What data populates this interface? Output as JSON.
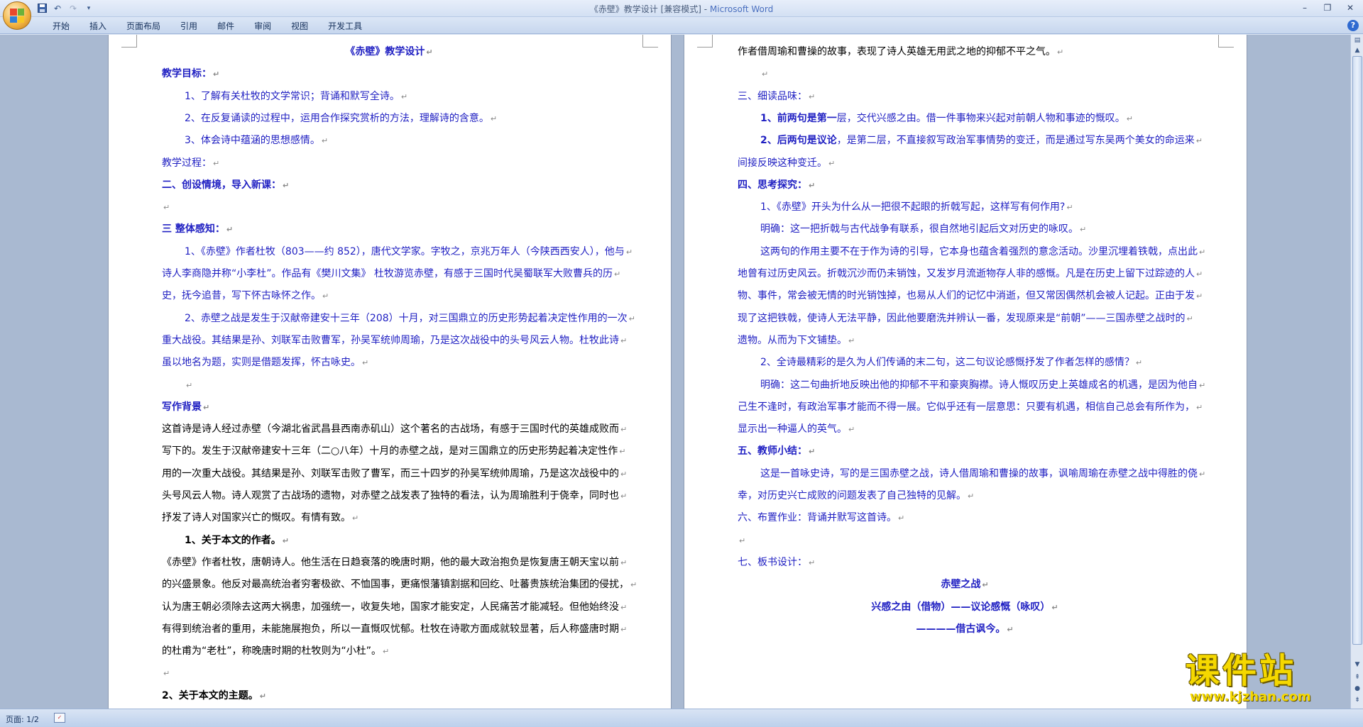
{
  "window": {
    "title_prefix": "《赤壁》教学设计 [兼容模式] - ",
    "app_name": "Microsoft Word"
  },
  "quick_access": [
    "save-icon",
    "undo-icon",
    "redo-icon",
    "customize-icon"
  ],
  "ribbon_tabs": [
    "开始",
    "插入",
    "页面布局",
    "引用",
    "邮件",
    "审阅",
    "视图",
    "开发工具"
  ],
  "status": {
    "page": "页面: 1/2"
  },
  "watermark": {
    "title": "课件站",
    "url": "www.kjzhan.com"
  },
  "left_page": [
    {
      "t": "《赤壁》教学设计",
      "style": "blue bold center"
    },
    {
      "t": "教学目标：",
      "style": "blue bold"
    },
    {
      "t": "1、了解有关杜牧的文学常识；背诵和默写全诗。",
      "style": "blue",
      "indent": 1
    },
    {
      "t": "2、在反复诵读的过程中，运用合作探究赏析的方法，理解诗的含意。",
      "style": "blue",
      "indent": 1
    },
    {
      "t": "3、体会诗中蕴涵的思想感情。",
      "style": "blue",
      "indent": 1
    },
    {
      "t": "教学过程：",
      "style": "blue"
    },
    {
      "t": "二、创设情境，导入新课：",
      "style": "blue bold"
    },
    {
      "t": "",
      "style": ""
    },
    {
      "t": "三 整体感知：",
      "style": "blue bold"
    },
    {
      "t": "1、《赤壁》作者杜牧（803——约 852），唐代文学家。字牧之，京兆万年人（今陕西西安人），他与",
      "style": "blue",
      "indent": 1
    },
    {
      "t": "诗人李商隐并称“小李杜”。作品有《樊川文集》 杜牧游览赤壁，有感于三国时代吴蜀联军大败曹兵的历",
      "style": "blue"
    },
    {
      "t": "史，抚今追昔，写下怀古咏怀之作。",
      "style": "blue"
    },
    {
      "t": "2、赤壁之战是发生于汉献帝建安十三年（208）十月，对三国鼎立的历史形势起着决定性作用的一次",
      "style": "blue",
      "indent": 1
    },
    {
      "t": "重大战役。其结果是孙、刘联军击败曹军，孙吴军统帅周瑜，乃是这次战役中的头号风云人物。杜牧此诗",
      "style": "blue"
    },
    {
      "t": "虽以地名为题，实则是借题发挥，怀古咏史。",
      "style": "blue"
    },
    {
      "t": "",
      "style": "",
      "indent": 1
    },
    {
      "t": "写作背景",
      "style": "blue bold"
    },
    {
      "t": "这首诗是诗人经过赤壁（今湖北省武昌县西南赤矶山）这个著名的古战场，有感于三国时代的英雄成败而",
      "style": ""
    },
    {
      "t": "写下的。发生于汉献帝建安十三年（二○八年）十月的赤壁之战，是对三国鼎立的历史形势起着决定性作",
      "style": ""
    },
    {
      "t": "用的一次重大战役。其结果是孙、刘联军击败了曹军，而三十四岁的孙吴军统帅周瑜，乃是这次战役中的",
      "style": ""
    },
    {
      "t": "头号风云人物。诗人观赏了古战场的遗物，对赤壁之战发表了独特的看法，认为周瑜胜利于侥幸，同时也",
      "style": ""
    },
    {
      "t": "抒发了诗人对国家兴亡的慨叹。有情有致。",
      "style": ""
    },
    {
      "t": "1、关于本文的作者。",
      "style": "bold",
      "indent": 1
    },
    {
      "t": "《赤壁》作者杜牧，唐朝诗人。他生活在日趋衰落的晚唐时期，他的最大政治抱负是恢复唐王朝天宝以前",
      "style": ""
    },
    {
      "t": "的兴盛景象。他反对最高统治者穷奢极欲、不恤国事，更痛恨藩镇割据和回纥、吐蕃贵族统治集团的侵扰，",
      "style": ""
    },
    {
      "t": "认为唐王朝必须除去这两大祸患，加强统一，收复失地，国家才能安定，人民痛苦才能减轻。但他始终没",
      "style": ""
    },
    {
      "t": "有得到统治者的重用，未能施展抱负，所以一直慨叹忧郁。杜牧在诗歌方面成就较显著，后人称盛唐时期",
      "style": ""
    },
    {
      "t": "的杜甫为“老杜”，称晚唐时期的杜牧则为“小杜”。",
      "style": ""
    },
    {
      "t": "",
      "style": ""
    },
    {
      "t": "2、关于本文的主题。",
      "style": "bold"
    }
  ],
  "right_page": [
    {
      "t": "作者借周瑜和曹操的故事，表现了诗人英雄无用武之地的抑郁不平之气。",
      "style": ""
    },
    {
      "t": "",
      "style": "",
      "indent": 1
    },
    {
      "t": "三、细读品味：",
      "style": "blue"
    },
    {
      "t": "1、前两句是第一层，交代兴感之由。借一件事物来兴起对前朝人物和事迹的慨叹。",
      "style": "blue",
      "indent": 1,
      "boldHead": 8
    },
    {
      "t": "2、后两句是议论，是第二层，不直接叙写政治军事情势的变迁，而是通过写东吴两个美女的命运来",
      "style": "blue",
      "indent": 1,
      "boldHead": 8
    },
    {
      "t": "间接反映这种变迁。",
      "style": "blue"
    },
    {
      "t": "四、思考探究：",
      "style": "blue bold"
    },
    {
      "t": "1、《赤壁》开头为什么从一把很不起眼的折戟写起，这样写有何作用?",
      "style": "blue",
      "indent": 1
    },
    {
      "t": "明确：这一把折戟与古代战争有联系，很自然地引起后文对历史的咏叹。",
      "style": "blue",
      "indent": 1
    },
    {
      "t": "这两句的作用主要不在于作为诗的引导，它本身也蕴含着强烈的意念活动。沙里沉埋着铁戟，点出此",
      "style": "blue",
      "indent": 1
    },
    {
      "t": "地曾有过历史风云。折戟沉沙而仍未销蚀，又发岁月流逝物存人非的感慨。凡是在历史上留下过踪迹的人",
      "style": "blue"
    },
    {
      "t": "物、事件，常会被无情的时光销蚀掉，也易从人们的记忆中消逝，但又常因偶然机会被人记起。正由于发",
      "style": "blue"
    },
    {
      "t": "现了这把铁戟，使诗人无法平静，因此他要磨洗并辨认一番，发现原来是“前朝”——三国赤壁之战时的",
      "style": "blue"
    },
    {
      "t": "遗物。从而为下文铺垫。",
      "style": "blue"
    },
    {
      "t": "2、全诗最精彩的是久为人们传诵的末二句，这二句议论感慨抒发了作者怎样的感情？",
      "style": "blue",
      "indent": 1
    },
    {
      "t": "明确：这二句曲折地反映出他的抑郁不平和豪爽胸襟。诗人慨叹历史上英雄成名的机遇，是因为他自",
      "style": "blue",
      "indent": 1
    },
    {
      "t": "己生不逢时，有政治军事才能而不得一展。它似乎还有一层意思：只要有机遇，相信自己总会有所作为，",
      "style": "blue"
    },
    {
      "t": "显示出一种逼人的英气。",
      "style": "blue"
    },
    {
      "t": "五、教师小结：",
      "style": "blue bold"
    },
    {
      "t": "这是一首咏史诗，写的是三国赤壁之战，诗人借周瑜和曹操的故事，讽喻周瑜在赤壁之战中得胜的侥",
      "style": "blue",
      "indent": 1
    },
    {
      "t": "幸，对历史兴亡成败的问题发表了自己独特的见解。",
      "style": "blue"
    },
    {
      "t": "六、布置作业：背诵并默写这首诗。",
      "style": "blue"
    },
    {
      "t": "",
      "style": ""
    },
    {
      "t": "七、板书设计：",
      "style": "blue"
    },
    {
      "t": "赤壁之战",
      "style": "blue bold center"
    },
    {
      "t": "兴感之由（借物）——议论感慨（咏叹）",
      "style": "blue bold center"
    },
    {
      "t": "————借古讽今。",
      "style": "blue bold center"
    }
  ]
}
